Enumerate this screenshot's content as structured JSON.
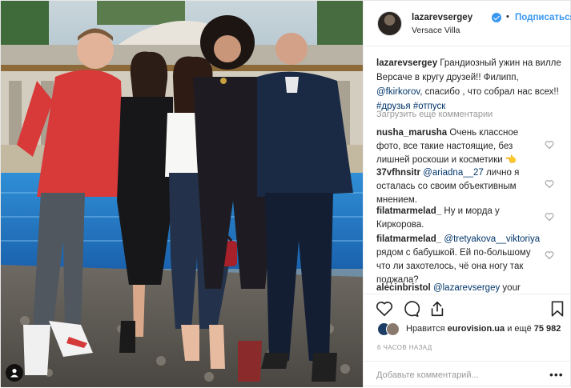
{
  "colors": {
    "accent": "#3897f0",
    "link": "#003569",
    "muted": "#999999",
    "text": "#262626"
  },
  "header": {
    "username": "lazarevsergey",
    "follow_label": "Подписаться",
    "separator": "•",
    "location": "Versace Villa"
  },
  "caption": {
    "username": "lazarevsergey",
    "text_1": "Грандиозный ужин на вилле Версаче в кругу друзей!! Филипп,",
    "mention": "@fkirkorov",
    "text_2": ", спасибо , что собрал нас всех!!",
    "hashtag_1": "#друзья",
    "hashtag_2": "#отпуск"
  },
  "load_more_label": "Загрузить еще комментарии",
  "comments": [
    {
      "username": "nusha_marusha",
      "mention": "",
      "text": "Очень классное фото, все такие настоящие, без лишней роскоши и косметики 👈"
    },
    {
      "username": "37vfhnsitr",
      "mention": "@ariadna__27",
      "text": "лично я осталась со своим объективным мнением."
    },
    {
      "username": "filatmarmelad_",
      "mention": "",
      "text": "Ну и морда у Киркорова."
    },
    {
      "username": "filatmarmelad_",
      "mention": "@tretyakova__viktoriya",
      "text": "рядом с бабушкой. Ей по-большому что ли захотелось, чё она ногу так поджала?"
    },
    {
      "username": "alecinbristol",
      "mention": "@lazarevsergey",
      "text": "your"
    }
  ],
  "likes": {
    "prefix": "Нравится",
    "user": "eurovision.ua",
    "middle": "и ещё",
    "count": "75 982"
  },
  "timestamp": "6 ЧАСОВ НАЗАД",
  "add_comment_placeholder": "Добавьте комментарий...",
  "icons": [
    "heart-icon",
    "comment-icon",
    "share-icon",
    "bookmark-icon",
    "more-icon",
    "user-tag-icon",
    "verified-icon"
  ]
}
